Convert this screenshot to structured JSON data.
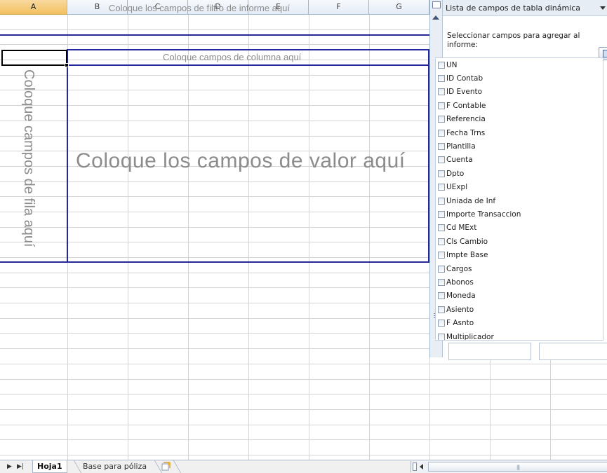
{
  "spreadsheet": {
    "columns": [
      "A",
      "B",
      "C",
      "D",
      "E",
      "F",
      "G"
    ],
    "selected_column": "A"
  },
  "pivot": {
    "filter_zone": "Coloque los campos de filtro de informe aquí",
    "column_zone": "Coloque campos de columna aquí",
    "row_zone": "Coloque campos de fila aquí",
    "value_zone": "Coloque los campos de valor aquí",
    "border_color": "#24289a"
  },
  "field_pane": {
    "title": "Lista de campos de tabla dinámica",
    "instructions": "Seleccionar campos para agregar al informe:",
    "fields": [
      "UN",
      "ID Contab",
      "ID Evento",
      "F Contable",
      "Referencia",
      "Fecha Trns",
      "Plantilla",
      "Cuenta",
      "Dpto",
      "UExpl",
      "Uniada de Inf",
      "Importe Transaccion",
      "Cd MExt",
      "Cls Cambio",
      "Impte Base",
      "Cargos",
      "Abonos",
      "Moneda",
      "Asiento",
      "F Asnto",
      "Multiplicador"
    ]
  },
  "sheet_tabs": {
    "active": "Hoja1",
    "other": "Base para póliza"
  }
}
